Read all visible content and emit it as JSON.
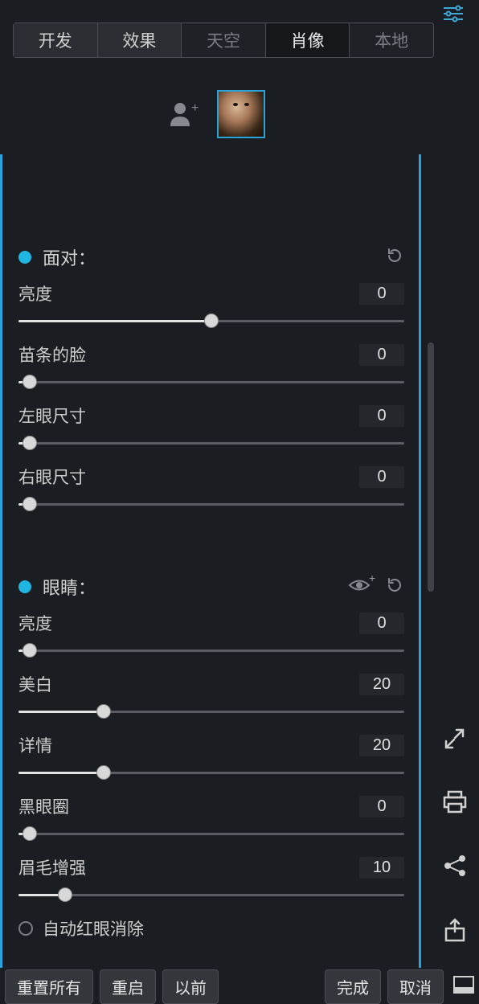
{
  "tabs": {
    "t0": "开发",
    "t1": "效果",
    "t2": "天空",
    "t3": "肖像",
    "t4": "本地"
  },
  "sections": {
    "face": {
      "title": "面对："
    },
    "eyes": {
      "title": "眼睛："
    }
  },
  "sliders": {
    "face_brightness": {
      "label": "亮度",
      "value": "0",
      "pct": 50
    },
    "slim_face": {
      "label": "苗条的脸",
      "value": "0",
      "pct": 3
    },
    "left_eye": {
      "label": "左眼尺寸",
      "value": "0",
      "pct": 3
    },
    "right_eye": {
      "label": "右眼尺寸",
      "value": "0",
      "pct": 3
    },
    "eye_brightness": {
      "label": "亮度",
      "value": "0",
      "pct": 3
    },
    "whiten": {
      "label": "美白",
      "value": "20",
      "pct": 22
    },
    "detail": {
      "label": "详情",
      "value": "20",
      "pct": 22
    },
    "dark_circle": {
      "label": "黑眼圈",
      "value": "0",
      "pct": 3
    },
    "eyebrow": {
      "label": "眉毛增强",
      "value": "10",
      "pct": 12
    }
  },
  "checkbox": {
    "auto_redeye": "自动红眼消除"
  },
  "bottom": {
    "reset_all": "重置所有",
    "restart": "重启",
    "before": "以前",
    "done": "完成",
    "cancel": "取消"
  }
}
